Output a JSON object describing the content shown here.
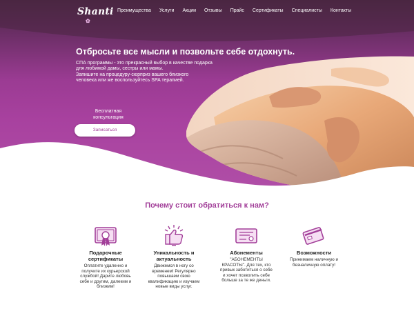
{
  "brand": {
    "logo_text": "Shanti"
  },
  "nav": {
    "items": [
      "Преимущества",
      "Услуги",
      "Акции",
      "Отзывы",
      "Прайс",
      "Сертификаты",
      "Специалисты",
      "Контакты"
    ]
  },
  "hero": {
    "headline": "Отбросьте все мысли и позвольте себе отдохнуть.",
    "lead_lines": [
      "СПА программы - это прекрасный выбор в качестве подарка",
      "для любимой дамы, сестры или мамы.",
      "Запишите на процедуру-сюрприз вашего близкого",
      "человека или же воспользуйтесь SPA терапией."
    ],
    "consult_line1": "Бесплатная",
    "consult_line2": "консультация",
    "cta_label": "Записаться"
  },
  "why": {
    "title": "Почему стоит обратиться к нам?",
    "features": [
      {
        "icon": "certificate-icon",
        "title_lines": [
          "Подарочные",
          "сертификаты"
        ],
        "text_lines": [
          "Оплатите удаленно и",
          "получите их курьерской",
          "службой! Дарите любовь",
          "себе и другим, далеким и",
          "близким!"
        ]
      },
      {
        "icon": "thumbs-up-icon",
        "title_lines": [
          "Уникальность и",
          "актуальность"
        ],
        "text_lines": [
          "Движемся в ногу со",
          "временем! Регулярно",
          "повышаем свою",
          "квалификацию и изучаем",
          "новые виды услуг."
        ]
      },
      {
        "icon": "diploma-icon",
        "title_lines": [
          "Абонементы"
        ],
        "text_lines": [
          "\"АБОНЕМЕНТЫ",
          "КРАСОТЫ\". Для тех, кто",
          "привык заботиться о себе",
          "и хочет позволить себе",
          "больше за те же деньги."
        ]
      },
      {
        "icon": "credit-card-icon",
        "title_lines": [
          "Возможности"
        ],
        "text_lines": [
          "Принимаем наличную и",
          "безналичную оплату!"
        ]
      }
    ]
  },
  "colors": {
    "accent": "#a23f99",
    "hero_dark": "#4a2742",
    "hero_mid": "#9b3b93"
  }
}
